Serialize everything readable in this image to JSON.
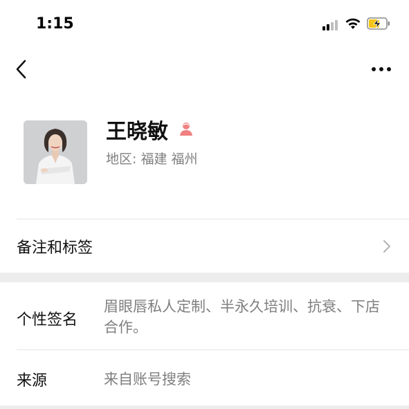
{
  "status_bar": {
    "time": "1:15"
  },
  "profile": {
    "name": "王晓敏",
    "region_label": "地区: ",
    "region_value": "福建 福州",
    "gender_icon": "female-user-icon"
  },
  "rows": {
    "remark": {
      "label": "备注和标签"
    },
    "signature": {
      "label": "个性签名",
      "value": "眉眼唇私人定制、半永久培训、抗衰、下店合作。"
    },
    "source": {
      "label": "来源",
      "value": "来自账号搜索"
    }
  },
  "colors": {
    "gender_icon": "#f08080",
    "secondary_text": "#7f7f7f",
    "section_gap": "#ededed",
    "battery_fill": "#f5c518"
  }
}
